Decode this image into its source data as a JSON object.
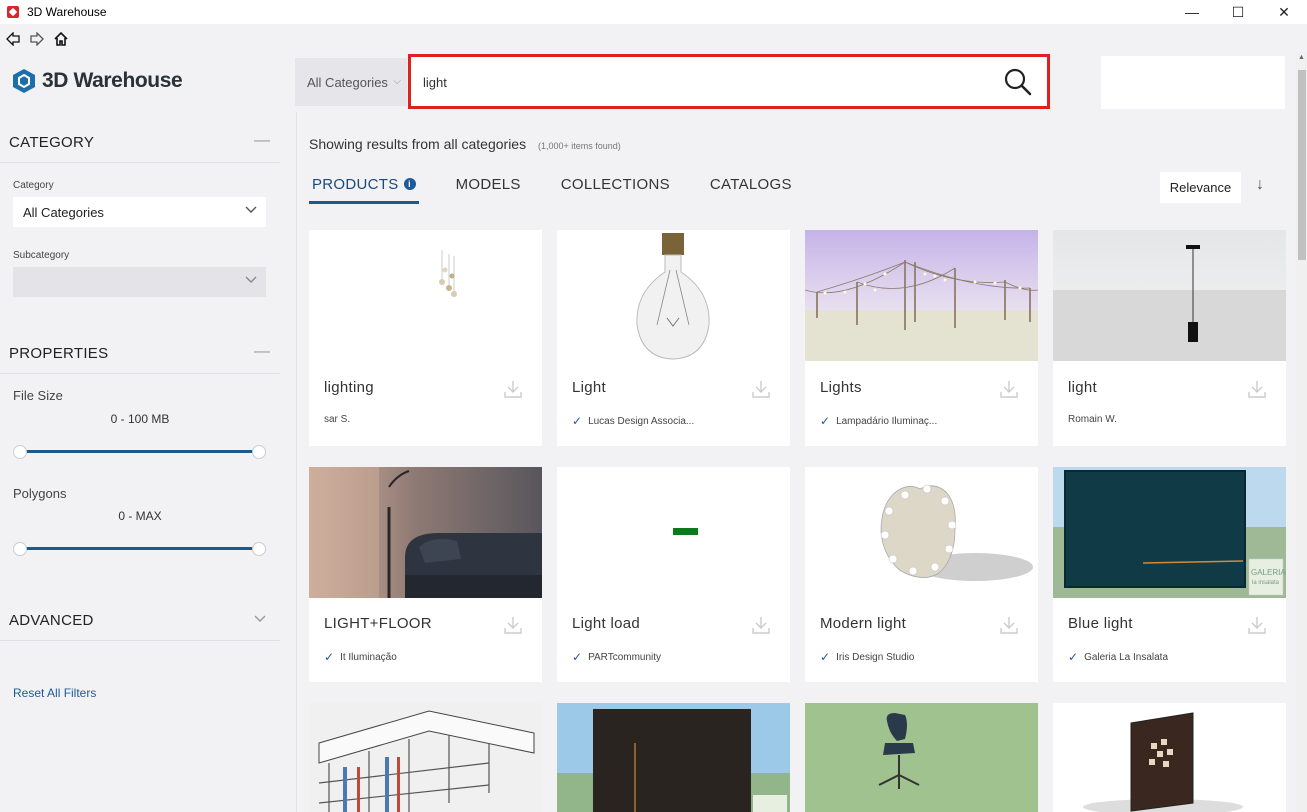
{
  "window": {
    "title": "3D Warehouse",
    "minimize_glyph": "—",
    "maximize_glyph": "☐",
    "close_glyph": "✕"
  },
  "nav": {
    "back_icon": "back-arrow-icon",
    "forward_icon": "forward-arrow-icon",
    "home_icon": "home-icon"
  },
  "header": {
    "logo_text": "3D Warehouse",
    "category_select": "All Categories",
    "search_value": "light"
  },
  "sidebar": {
    "category_heading": "CATEGORY",
    "category_label": "Category",
    "category_value": "All Categories",
    "subcategory_label": "Subcategory",
    "subcategory_value": "",
    "properties_heading": "PROPERTIES",
    "file_size_label": "File Size",
    "file_size_range": "0 - 100 MB",
    "polygons_label": "Polygons",
    "polygons_range": "0 - MAX",
    "advanced_heading": "ADVANCED",
    "reset_link": "Reset All Filters",
    "collapse_glyph": "—",
    "expand_glyph": "⌄"
  },
  "main": {
    "showing_text": "Showing results from all categories",
    "count_text": "(1,000+ items found)",
    "tabs": [
      {
        "label": "PRODUCTS",
        "active": true
      },
      {
        "label": "MODELS",
        "active": false
      },
      {
        "label": "COLLECTIONS",
        "active": false
      },
      {
        "label": "CATALOGS",
        "active": false
      }
    ],
    "info_glyph": "i",
    "sort_label": "Relevance",
    "sort_direction_glyph": "↓"
  },
  "results": [
    {
      "title": "lighting",
      "author": "sar S.",
      "verified": false
    },
    {
      "title": "Light",
      "author": "Lucas Design Associa...",
      "verified": true
    },
    {
      "title": "Lights",
      "author": "Lampadário Iluminaç...",
      "verified": true
    },
    {
      "title": "light",
      "author": "Romain W.",
      "verified": false
    },
    {
      "title": "LIGHT+FLOOR",
      "author": "It Iluminação",
      "verified": true
    },
    {
      "title": "Light load",
      "author": "PARTcommunity",
      "verified": true
    },
    {
      "title": "Modern light",
      "author": "Iris Design Studio",
      "verified": true
    },
    {
      "title": "Blue light",
      "author": "Galeria La Insalata",
      "verified": true
    }
  ],
  "thumb_watermarks": {
    "blue_light": "GALERIA la insalata"
  },
  "colors": {
    "accent_blue": "#1d5a8c",
    "search_highlight": "#e0201e",
    "verified_check": "#1d5a9c"
  }
}
